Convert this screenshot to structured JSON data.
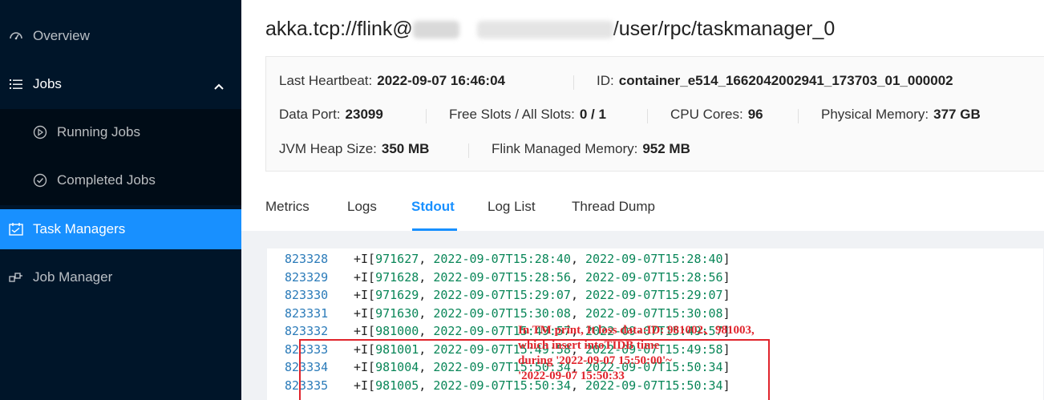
{
  "sidebar": {
    "items": [
      {
        "label": "Overview",
        "icon": "dashboard-icon"
      },
      {
        "label": "Jobs",
        "icon": "list-icon"
      },
      {
        "label": "Running Jobs",
        "icon": "play-circle-icon"
      },
      {
        "label": "Completed Jobs",
        "icon": "check-circle-icon"
      },
      {
        "label": "Task Managers",
        "icon": "schedule-icon"
      },
      {
        "label": "Job Manager",
        "icon": "cluster-icon"
      }
    ]
  },
  "header": {
    "title_prefix": "akka.tcp://flink@",
    "title_suffix": "/user/rpc/taskmanager_0"
  },
  "details": {
    "last_heartbeat_label": "Last Heartbeat:",
    "last_heartbeat": "2022-09-07 16:46:04",
    "id_label": "ID:",
    "id": "container_e514_1662042002941_173703_01_000002",
    "data_port_label": "Data Port:",
    "data_port": "23099",
    "free_slots_label": "Free Slots / All Slots:",
    "free_slots": "0 / 1",
    "cpu_cores_label": "CPU Cores:",
    "cpu_cores": "96",
    "physical_memory_label": "Physical Memory:",
    "physical_memory": "377 GB",
    "jvm_heap_label": "JVM Heap Size:",
    "jvm_heap": "350 MB",
    "managed_memory_label": "Flink Managed Memory:",
    "managed_memory": "952 MB"
  },
  "tabs": [
    "Metrics",
    "Logs",
    "Stdout",
    "Log List",
    "Thread Dump"
  ],
  "active_tab": "Stdout",
  "log": [
    {
      "num": "823328",
      "id": "971627",
      "t1": "2022-09-07T15:28:40",
      "t2": "2022-09-07T15:28:40"
    },
    {
      "num": "823329",
      "id": "971628",
      "t1": "2022-09-07T15:28:56",
      "t2": "2022-09-07T15:28:56"
    },
    {
      "num": "823330",
      "id": "971629",
      "t1": "2022-09-07T15:29:07",
      "t2": "2022-09-07T15:29:07"
    },
    {
      "num": "823331",
      "id": "971630",
      "t1": "2022-09-07T15:30:08",
      "t2": "2022-09-07T15:30:08"
    },
    {
      "num": "823332",
      "id": "981000",
      "t1": "2022-09-07T15:49:57",
      "t2": "2022-09-07T15:49:57"
    },
    {
      "num": "823333",
      "id": "981001",
      "t1": "2022-09-07T15:49:58",
      "t2": "2022-09-07T15:49:58"
    },
    {
      "num": "823334",
      "id": "981004",
      "t1": "2022-09-07T15:50:34",
      "t2": "2022-09-07T15:50:34"
    },
    {
      "num": "823335",
      "id": "981005",
      "t1": "2022-09-07T15:50:34",
      "t2": "2022-09-07T15:50:34"
    }
  ],
  "annotation": {
    "line1": "In TM print, It loss data:ID: 981002、981003,",
    "line2": "which insert intoTIDB time",
    "line3": "during '2022-09-07 15:50:00'~",
    "line4": "'2022-09-07 15:50:33"
  },
  "colors": {
    "sidebar_bg": "#001529",
    "active": "#1890ff",
    "annotation": "#e0242c"
  }
}
